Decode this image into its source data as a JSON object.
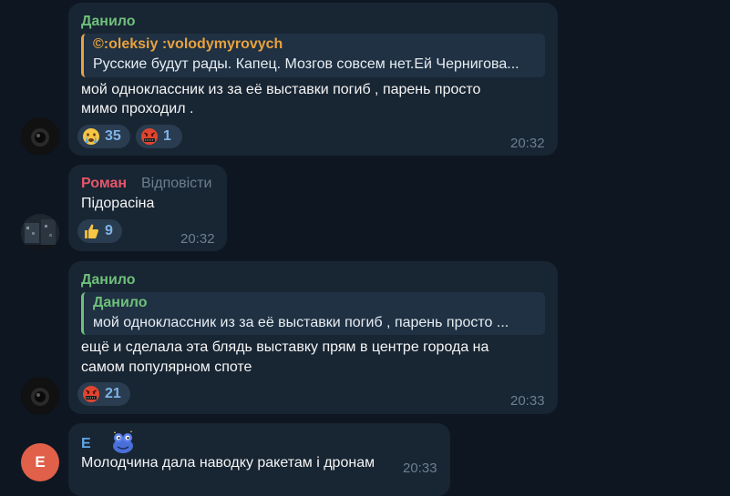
{
  "messages": [
    {
      "author": "Данило",
      "author_color": "#6ec07a",
      "quote": {
        "author": "©:oleksiy :volodymyrovych",
        "author_color": "#e8a23f",
        "text": "Русские будут рады. Капец. Мозгов совсем нет.Ей Чернигова..."
      },
      "lines": [
        "мой одноклассник из за её выставки погиб , парень просто",
        "мимо проходил ."
      ],
      "reactions": [
        {
          "emoji": "crying-face-emoji",
          "count": "35"
        },
        {
          "emoji": "angry-censored-face-emoji",
          "count": "1"
        }
      ],
      "time": "20:32"
    },
    {
      "author": "Роман",
      "author_color": "#e8566a",
      "reply_label": "Відповісти",
      "lines": [
        "Підорасіна"
      ],
      "reactions": [
        {
          "emoji": "thumbs-up-emoji",
          "count": "9"
        }
      ],
      "time": "20:32"
    },
    {
      "author": "Данило",
      "author_color": "#6ec07a",
      "quote": {
        "author": "Данило",
        "author_color": "#6ec07a",
        "text": "мой одноклассник из за её выставки погиб , парень просто ..."
      },
      "lines": [
        "ещё и сделала эта блядь выставку прям в центре города на",
        "самом популярном споте"
      ],
      "reactions": [
        {
          "emoji": "angry-censored-face-emoji",
          "count": "21"
        }
      ],
      "time": "20:33"
    },
    {
      "author": "Е",
      "author_color": "#5fa8e6",
      "avatar_letter": "Е",
      "avatar_color": "#e0604a",
      "lines": [
        "Молодчина дала наводку ракетам і дронам"
      ],
      "time": "20:33"
    }
  ],
  "colors": {
    "background": "#0e1621",
    "bubble": "#182533",
    "quote_bg": "#1f3143",
    "timestamp": "#6d7f8f",
    "reaction_bg": "#2a3c4f",
    "reaction_count": "#7fb3e8"
  }
}
